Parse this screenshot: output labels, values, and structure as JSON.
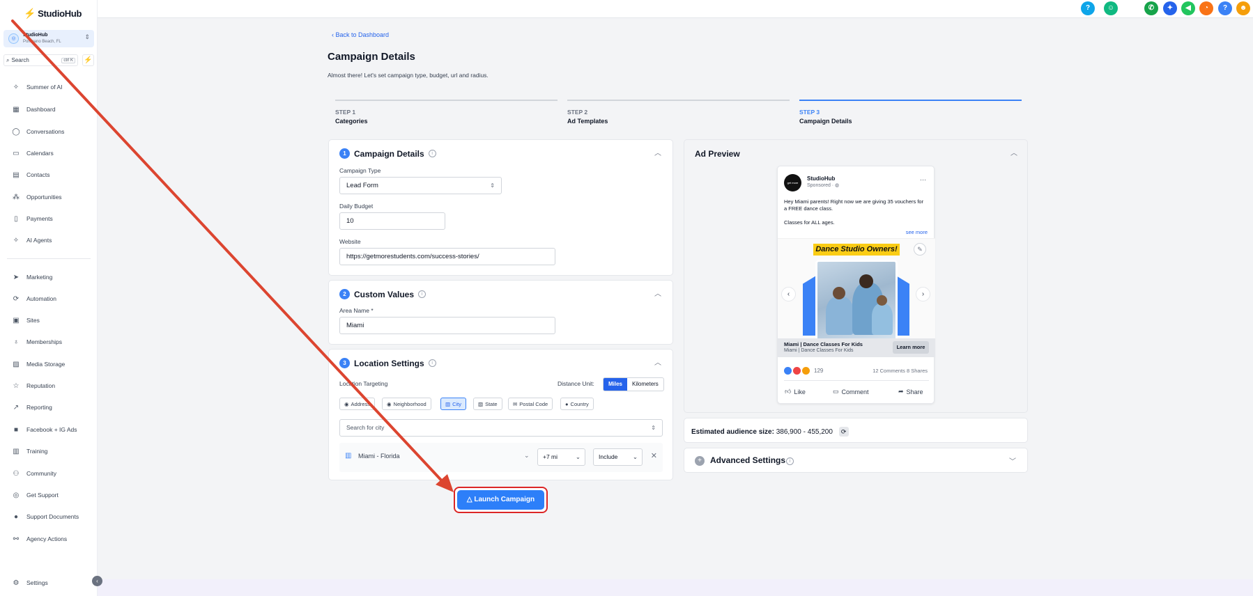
{
  "brand": {
    "name": "StudioHub"
  },
  "account": {
    "name": "StudioHub",
    "location": "Pompano Beach, FL"
  },
  "search": {
    "label": "Search",
    "shortcut": "ctrl K"
  },
  "sidebar": {
    "items": [
      {
        "label": "Summer of AI",
        "icon": "sparkle-icon"
      },
      {
        "label": "Dashboard",
        "icon": "dashboard-icon"
      },
      {
        "label": "Conversations",
        "icon": "chat-icon"
      },
      {
        "label": "Calendars",
        "icon": "calendar-icon"
      },
      {
        "label": "Contacts",
        "icon": "contacts-icon"
      },
      {
        "label": "Opportunities",
        "icon": "opportunities-icon"
      },
      {
        "label": "Payments",
        "icon": "payments-icon"
      },
      {
        "label": "AI Agents",
        "icon": "ai-agents-icon"
      },
      {
        "label": "Marketing",
        "icon": "send-icon"
      },
      {
        "label": "Automation",
        "icon": "automation-icon"
      },
      {
        "label": "Sites",
        "icon": "sites-icon"
      },
      {
        "label": "Memberships",
        "icon": "membership-icon"
      },
      {
        "label": "Media Storage",
        "icon": "image-icon"
      },
      {
        "label": "Reputation",
        "icon": "star-icon"
      },
      {
        "label": "Reporting",
        "icon": "trend-icon"
      },
      {
        "label": "Facebook + IG Ads",
        "icon": "facebook-icon"
      },
      {
        "label": "Training",
        "icon": "book-icon"
      },
      {
        "label": "Community",
        "icon": "community-icon"
      },
      {
        "label": "Get Support",
        "icon": "support-icon"
      },
      {
        "label": "Support Documents",
        "icon": "info-icon"
      },
      {
        "label": "Agency Actions",
        "icon": "agency-icon"
      }
    ],
    "settings": "Settings"
  },
  "page": {
    "back": "Back to Dashboard",
    "title": "Campaign Details",
    "subtitle": "Almost there! Let's set campaign type, budget, url and radius."
  },
  "steps": [
    {
      "step": "STEP 1",
      "name": "Categories"
    },
    {
      "step": "STEP 2",
      "name": "Ad Templates"
    },
    {
      "step": "STEP 3",
      "name": "Campaign Details"
    }
  ],
  "campaign": {
    "num": "1",
    "title": "Campaign Details",
    "type_label": "Campaign Type",
    "type_value": "Lead Form",
    "budget_label": "Daily Budget",
    "budget_value": "10",
    "website_label": "Website",
    "website_value": "https://getmorestudents.com/success-stories/"
  },
  "custom": {
    "num": "2",
    "title": "Custom Values",
    "area_label": "Area Name *",
    "area_value": "Miami"
  },
  "location": {
    "num": "3",
    "title": "Location Settings",
    "targeting_label": "Location Targeting",
    "unit_label": "Distance Unit:",
    "unit_miles": "Miles",
    "unit_km": "Kilometers",
    "chips": [
      "Address",
      "Neighborhood",
      "City",
      "State",
      "Postal Code",
      "Country"
    ],
    "search_placeholder": "Search for city",
    "city": "Miami - Florida",
    "radius": "+7 mi",
    "include": "Include"
  },
  "launch": "Launch Campaign",
  "preview": {
    "title": "Ad Preview",
    "page_name": "StudioHub",
    "sponsored": "Sponsored · ",
    "avatar_text": "get more",
    "text1": "Hey Miami parents! Right now we are giving 35 vouchers for a FREE dance class.",
    "text2": "Classes for ALL ages.",
    "see_more": "see more",
    "banner": "Dance Studio Owners!",
    "cta_title": "Miami | Dance Classes For Kids",
    "cta_sub": "Miami | Dance Classes For Kids",
    "cta_button": "Learn more",
    "reactions": "129",
    "comments_shares": "12 Comments 8 Shares",
    "like": "Like",
    "comment": "Comment",
    "share": "Share"
  },
  "audience": {
    "label": "Estimated audience size:",
    "value": "386,900 - 455,200"
  },
  "advanced": {
    "title": "Advanced Settings"
  },
  "colors": {
    "primary": "#2d7ff9",
    "highlight": "#dc2626"
  }
}
